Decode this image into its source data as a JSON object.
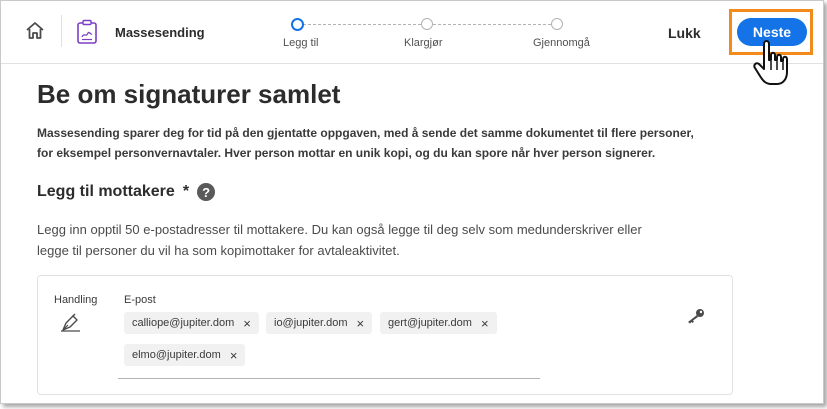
{
  "header": {
    "app_title": "Massesending",
    "close_label": "Lukk",
    "next_label": "Neste",
    "icons": {
      "home": "home-icon",
      "document": "document-icon",
      "cursor": "hand-pointer-icon"
    },
    "highlight_color": "#f28b1c",
    "accent_color": "#1473e6"
  },
  "stepper": {
    "steps": [
      {
        "label": "Legg til",
        "state": "active"
      },
      {
        "label": "Klargjør",
        "state": "pending"
      },
      {
        "label": "Gjennomgå",
        "state": "pending"
      }
    ]
  },
  "main": {
    "title": "Be om signaturer samlet",
    "intro_line1": "Massesending sparer deg for tid på den gjentatte oppgaven, med å sende det samme dokumentet til flere personer,",
    "intro_line2": "for eksempel personvernavtaler. Hver person mottar en unik kopi, og du kan spore når hver person signerer.",
    "section_title": "Legg til mottakere",
    "required_mark": "*",
    "help_glyph": "?",
    "desc_line1": "Legg inn opptil 50 e-postadresser til mottakere. Du kan også legge til deg selv som medunderskriver eller",
    "desc_line2": "legge til personer du vil ha som kopimottaker for avtaleaktivitet."
  },
  "recipients": {
    "role_label": "Handling",
    "email_label": "E-post",
    "role_icon": "pen-icon",
    "auth_icon": "key-icon",
    "emails": [
      "calliope@jupiter.dom",
      "io@jupiter.dom",
      "gert@jupiter.dom",
      "elmo@jupiter.dom"
    ],
    "remove_glyph": "×"
  }
}
